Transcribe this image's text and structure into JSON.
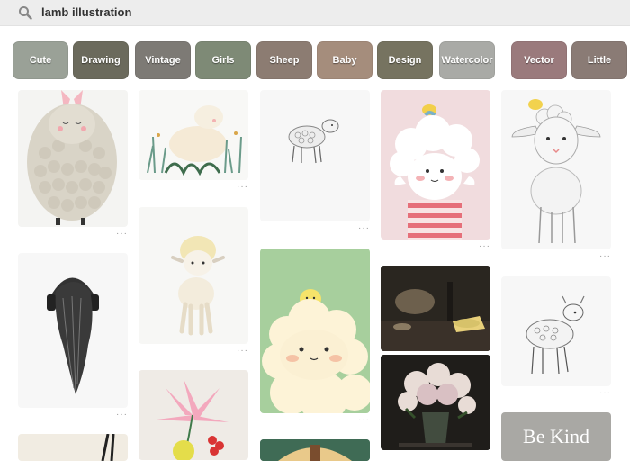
{
  "search": {
    "query": "lamb illustration"
  },
  "chips": [
    {
      "label": "Cute",
      "color": "#9aa197"
    },
    {
      "label": "Drawing",
      "color": "#6b6a5c"
    },
    {
      "label": "Vintage",
      "color": "#7d7a75"
    },
    {
      "label": "Girls",
      "color": "#7e8a76"
    },
    {
      "label": "Sheep",
      "color": "#8c7c72"
    },
    {
      "label": "Baby",
      "color": "#a58d7c"
    },
    {
      "label": "Design",
      "color": "#767360"
    },
    {
      "label": "Watercolor",
      "color": "#a9aaa6"
    },
    {
      "label": "Vector",
      "color": "#9a7a7c"
    },
    {
      "label": "Little",
      "color": "#8a7b75"
    }
  ],
  "pins": {
    "more_label": "···",
    "bekind_text": "Be Kind"
  },
  "icons": [
    "search-icon"
  ]
}
